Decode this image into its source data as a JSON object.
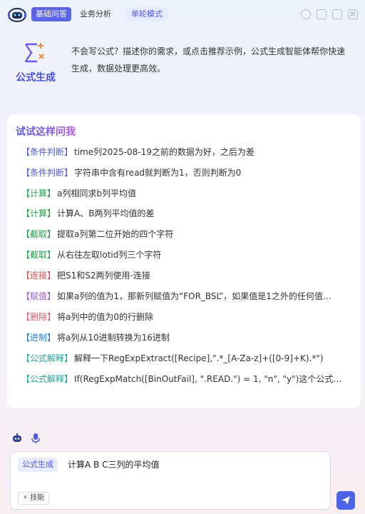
{
  "header": {
    "tabs": [
      "基础问答",
      "业务分析"
    ],
    "mode_label": "单轮模式",
    "icons": [
      "history-icon",
      "export-icon",
      "window-icon",
      "close-icon"
    ]
  },
  "intro": {
    "icon": "sigma-formula-icon",
    "title": "公式生成",
    "description": "不会写公式？描述你的需求，或点击推荐示例，公式生成智能体帮你快速生成，数据处理更高效。"
  },
  "suggestions": {
    "title": "试试这样问我",
    "items": [
      {
        "tag": "【条件判断】",
        "text": "time列2025-08-19之前的数据为好，之后为差",
        "color": "#4d59e8"
      },
      {
        "tag": "【条件判断】",
        "text": "字符串中含有read就判断为1，否则判断为0",
        "color": "#4d59e8"
      },
      {
        "tag": "【计算】",
        "text": "a列相同求b列平均值",
        "color": "#24a04b"
      },
      {
        "tag": "【计算】",
        "text": "计算A、B两列平均值的差",
        "color": "#24a04b"
      },
      {
        "tag": "【截取】",
        "text": "提取a列第二位开始的四个字符",
        "color": "#24a04b"
      },
      {
        "tag": "【截取】",
        "text": "从右往左取lotid列三个字符",
        "color": "#24a04b"
      },
      {
        "tag": "【连接】",
        "text": "把S1和S2两列使用-连接",
        "color": "#d9534f"
      },
      {
        "tag": "【赋值】",
        "text": "如果a列的值为1，那新列赋值为“FOR_BSL”，如果值是1之外的任何值…",
        "color": "#9b59d6"
      },
      {
        "tag": "【删除】",
        "text": "将a列中的值为0的行删除",
        "color": "#e0576b"
      },
      {
        "tag": "【进制】",
        "text": "将a列从10进制转换为16进制",
        "color": "#2c7bd0"
      },
      {
        "tag": "【公式解释】",
        "text": "解释一下RegExpExtract([Recipe],\".*_[A-Za-z]+([0-9]+K).*\")",
        "color": "#1ea7a0"
      },
      {
        "tag": "【公式解释】",
        "text": "If(RegExpMatch([BinOutFail], \".READ.\") = 1, \"n\", \"y\")这个公式是什…",
        "color": "#1ea7a0"
      }
    ]
  },
  "input": {
    "mode_tag": "公式生成",
    "value": "计算A B C三列的平均值",
    "skill_label": "技能",
    "tool_icons": [
      "robot-icon",
      "microphone-icon"
    ],
    "send_icon": "send-icon"
  }
}
